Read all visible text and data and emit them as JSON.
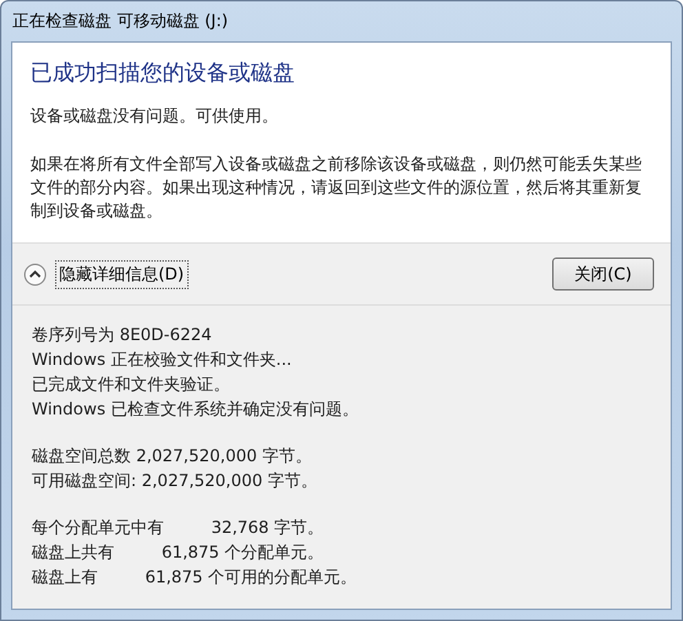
{
  "window": {
    "title": "正在检查磁盘 可移动磁盘 (J:)"
  },
  "result": {
    "heading": "已成功扫描您的设备或磁盘",
    "status": "设备或磁盘没有问题。可供使用。",
    "warning": "如果在将所有文件全部写入设备或磁盘之前移除该设备或磁盘，则仍然可能丢失某些文件的部分内容。如果出现这种情况，请返回到这些文件的源位置，然后将其重新复制到设备或磁盘。"
  },
  "details_toggle": {
    "label": "隐藏详细信息(D)",
    "expanded": true
  },
  "buttons": [
    "关闭(C)"
  ],
  "details_log": [
    [
      "卷序列号为 8E0D-6224",
      "Windows 正在校验文件和文件夹...",
      "已完成文件和文件夹验证。",
      "Windows 已检查文件系统并确定没有问题。"
    ],
    [
      "磁盘空间总数 2,027,520,000 字节。",
      "可用磁盘空间: 2,027,520,000 字节。"
    ],
    [
      "每个分配单元中有         32,768 字节。",
      "磁盘上共有         61,875 个分配单元。",
      "磁盘上有         61,875 个可用的分配单元。"
    ]
  ]
}
